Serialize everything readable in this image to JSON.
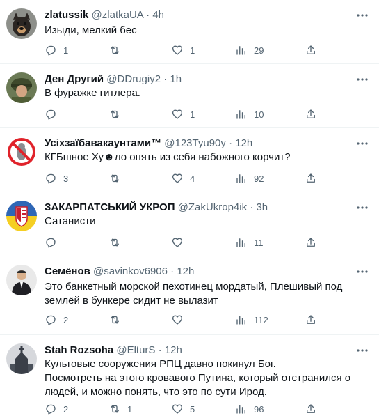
{
  "tweets": [
    {
      "name": "zlatussik",
      "handle": "@zlatkaUA",
      "sep": "·",
      "time": "4h",
      "text": "Изыди, мелкий бес",
      "reply": "1",
      "retweet": "",
      "like": "1",
      "views": "29",
      "avatar_icon": "dog-avatar-icon"
    },
    {
      "name": "Ден Другий",
      "handle": "@DDrugiy2",
      "sep": "·",
      "time": "1h",
      "text": "В фуражке гитлера.",
      "reply": "",
      "retweet": "",
      "like": "1",
      "views": "10",
      "avatar_icon": "soldier-avatar-icon"
    },
    {
      "name": "Усіхзаїбавакаунтами™",
      "handle": "@123Tyu90y",
      "sep": "·",
      "time": "12h",
      "text": "КГБшное Ху☻ло опять из себя набожного корчит?",
      "reply": "3",
      "retweet": "",
      "like": "4",
      "views": "92",
      "avatar_icon": "prohibited-rat-avatar-icon"
    },
    {
      "name": "ЗАКАРПАТСЬКИЙ УКРОП",
      "handle": "@ZakUkrop4ik",
      "sep": "·",
      "time": "3h",
      "text": "Сатанисти",
      "reply": "",
      "retweet": "",
      "like": "",
      "views": "11",
      "avatar_icon": "coat-of-arms-avatar-icon"
    },
    {
      "name": "Семёнов",
      "handle": "@savinkov6906",
      "sep": "·",
      "time": "12h",
      "text": "Это банкетный морской пехотинец мордатый, Плешивый под землёй в бункере сидит не вылазит",
      "reply": "2",
      "retweet": "",
      "like": "",
      "views": "112",
      "avatar_icon": "man-in-suit-avatar-icon"
    },
    {
      "name": "Stah Rozsoha",
      "handle": "@ElturS",
      "sep": "·",
      "time": "12h",
      "text": "Культовые сооружения РПЦ давно покинул Бог.\nПосмотреть на этого кровавого Путина, который отстранился о людей, и можно понять, что это по сути Ирод.",
      "reply": "2",
      "retweet": "1",
      "like": "5",
      "views": "96",
      "avatar_icon": "church-avatar-icon"
    }
  ],
  "colors": {
    "text": "#0f1419",
    "secondary": "#536471",
    "divider": "#eff3f4"
  }
}
